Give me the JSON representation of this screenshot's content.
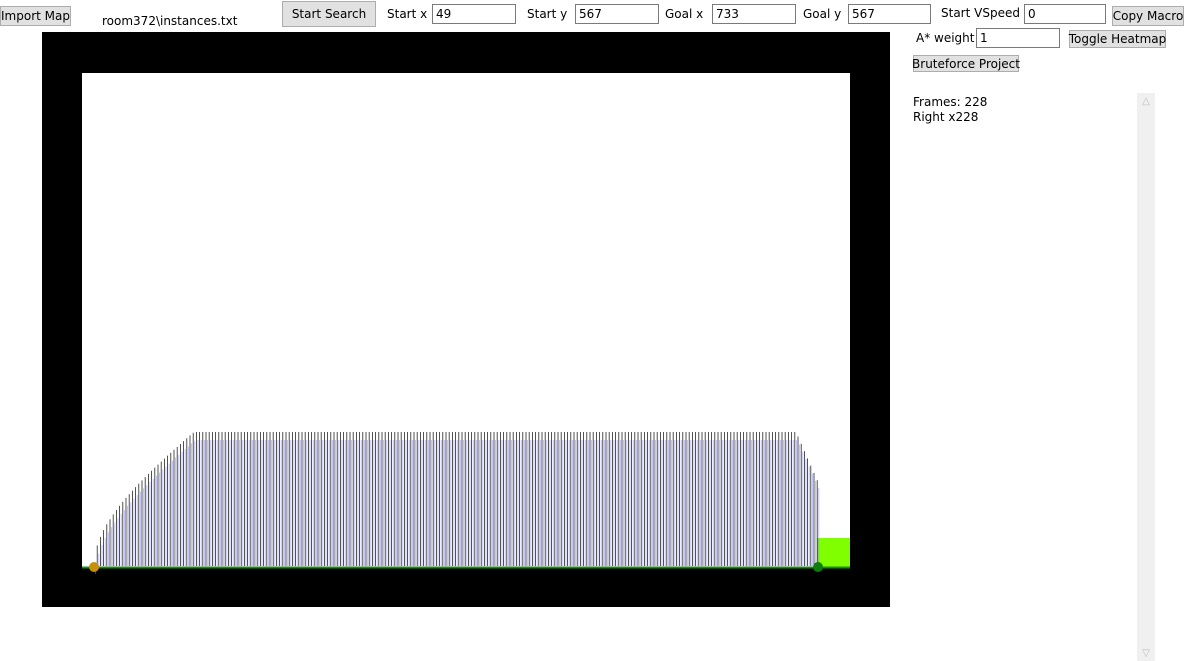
{
  "toolbar": {
    "import_map": "Import Map",
    "file_name": "room372\\instances.txt",
    "start_search": "Start Search",
    "start_x_label": "Start x",
    "start_x_value": "49",
    "start_y_label": "Start y",
    "start_y_value": "567",
    "goal_x_label": "Goal x",
    "goal_x_value": "733",
    "goal_y_label": "Goal y",
    "goal_y_value": "567",
    "start_vspeed_label": "Start VSpeed",
    "start_vspeed_value": "0",
    "copy_macro": "Copy Macro",
    "astar_weight_label": "A* weight",
    "astar_weight_value": "1",
    "toggle_heatmap": "Toggle Heatmap",
    "bruteforce_project": "Bruteforce Project"
  },
  "results": {
    "frames": "Frames: 228",
    "inputs": "Right x228"
  },
  "colors": {
    "wall": "#000000",
    "floor_line": "#1a8a1a",
    "goal_block": "#80ff00",
    "start_marker": "#c8900a",
    "goal_marker": "#0d7d0d",
    "trace_dark": "#000000",
    "trace_blue": "#8080ff"
  }
}
